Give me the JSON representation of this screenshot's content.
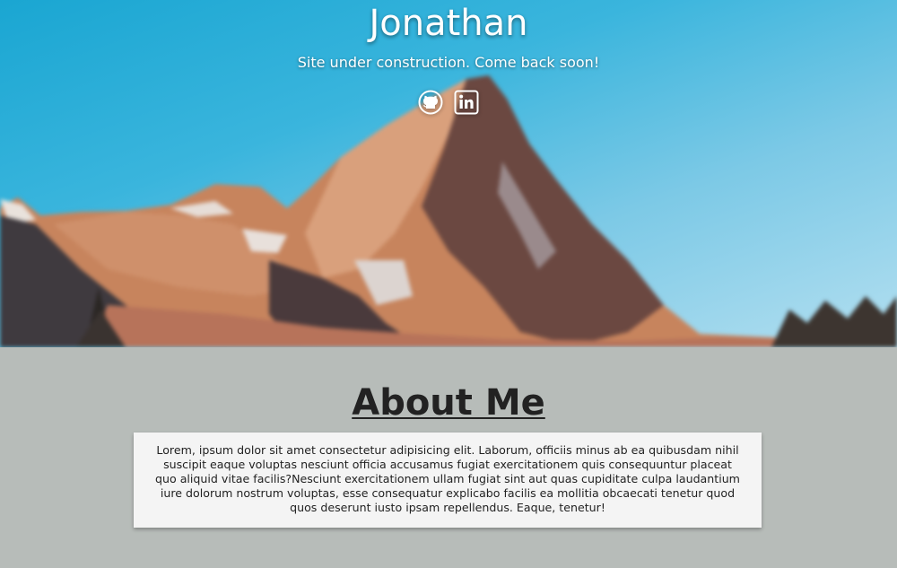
{
  "hero": {
    "title": "Jonathan",
    "subtitle": "Site under construction. Come back soon!",
    "social": [
      {
        "icon": "github-icon"
      },
      {
        "icon": "linkedin-icon"
      }
    ],
    "colors": {
      "sky_top": "#1aa6d2",
      "sky_bottom": "#b3dff0",
      "mountain_light": "#c98a66",
      "mountain_dark": "#5a3b34"
    }
  },
  "about": {
    "heading": "About Me",
    "body": "Lorem, ipsum dolor sit amet consectetur adipisicing elit. Laborum, officiis minus ab ea quibusdam nihil suscipit eaque voluptas nesciunt officia accusamus fugiat exercitationem quis consequuntur placeat quo aliquid vitae facilis?Nesciunt exercitationem ullam fugiat sint aut quas cupiditate culpa laudantium iure dolorum nostrum voluptas, esse consequatur explicabo facilis ea mollitia obcaecati tenetur quod quos deserunt iusto ipsam repellendus. Eaque, tenetur!",
    "colors": {
      "section_bg": "#b7bcb9",
      "card_bg": "#f4f4f4"
    }
  }
}
